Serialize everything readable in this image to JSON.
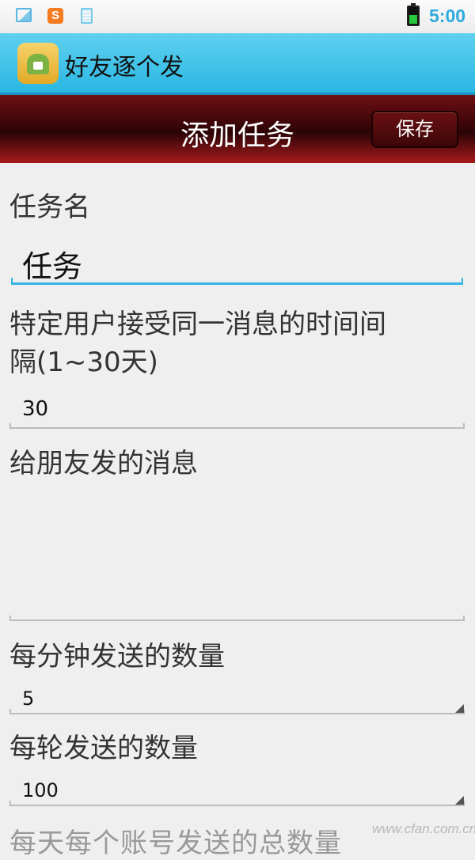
{
  "status_bar": {
    "icons": [
      "gallery-icon",
      "sogou-input-icon",
      "clipboard-icon",
      "battery-icon"
    ],
    "sogou_letter": "S",
    "time": "5:00"
  },
  "app_bar": {
    "title": "好友逐个发"
  },
  "header": {
    "title": "添加任务",
    "save_label": "保存"
  },
  "form": {
    "task_name": {
      "label": "任务名",
      "value": "任务"
    },
    "interval": {
      "label_line1": "特定用户接受同一消息的时间间",
      "label_line2": "隔(1~30天)",
      "value": "30"
    },
    "message": {
      "label": "给朋友发的消息",
      "value": ""
    },
    "per_minute": {
      "label": "每分钟发送的数量",
      "value": "5"
    },
    "per_round": {
      "label": "每轮发送的数量",
      "value": "100"
    },
    "next_label_partial": "每天每个账号发送的总数量"
  },
  "watermark": "www.cfan.com.cn",
  "colors": {
    "accent": "#35b5e5",
    "header_dark_red": "#3a0508",
    "app_bar_blue": "#2ab7e3",
    "battery_green": "#28c63a"
  }
}
